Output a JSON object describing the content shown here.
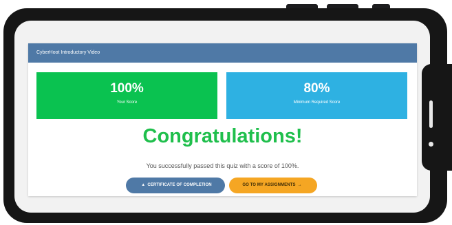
{
  "video": {
    "title": "CyberHoot Introductory Video"
  },
  "scores": {
    "yours": {
      "value": "100%",
      "label": "Your Score",
      "color": "#0ac250"
    },
    "required": {
      "value": "80%",
      "label": "Minimum Required Score",
      "color": "#2eb1e2"
    }
  },
  "result": {
    "heading": "Congratulations!",
    "message": "You successfully passed this quiz with a score of 100%."
  },
  "actions": {
    "certificate_label": "CERTIFICATE OF COMPLETION",
    "certificate_icon": "warning-triangle-icon",
    "assignments_label": "GO TO MY ASSIGNMENTS",
    "assignments_icon": "arrow-right-icon"
  },
  "colors": {
    "accent_blue": "#4f79a6",
    "success_green": "#1fbf4c",
    "orange": "#f5a623"
  }
}
